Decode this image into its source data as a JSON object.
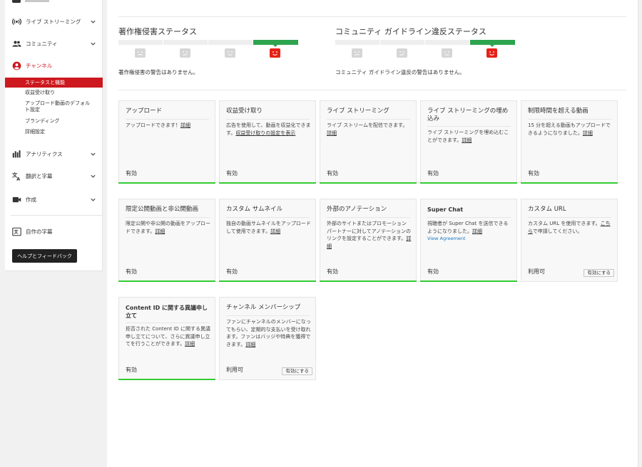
{
  "sidebar": {
    "items": [
      {
        "label": "ライブ ストリーミング",
        "icon": "live-streaming-icon"
      },
      {
        "label": "コミュニティ",
        "icon": "community-icon"
      },
      {
        "label": "チャンネル",
        "icon": "channel-icon"
      },
      {
        "label": "アナリティクス",
        "icon": "analytics-icon"
      },
      {
        "label": "翻訳と字幕",
        "icon": "translate-icon"
      },
      {
        "label": "作成",
        "icon": "create-icon"
      },
      {
        "label": "自作の字幕",
        "icon": "subtitles-icon"
      }
    ],
    "channel_subitems": [
      "ステータスと機能",
      "収益受け取り",
      "アップロード動画のデフォルト設定",
      "ブランディング",
      "詳細設定"
    ],
    "help_label": "ヘルプとフィードバック"
  },
  "copyright_status": {
    "title": "著作権侵害ステータス",
    "note": "著作権侵害の警告はありません。"
  },
  "guidelines_status": {
    "title": "コミュニティ ガイドライン違反ステータス",
    "note": "コミュニティ ガイドライン違反の警告はありません。"
  },
  "link_detail": "詳細",
  "cards": [
    {
      "title": "アップロード",
      "desc": "アップロードできます！",
      "link": "詳細",
      "status": "有効"
    },
    {
      "title": "収益受け取り",
      "desc": "広告を使用して、動画を収益化できます。",
      "link": "収益受け取りの設定を表示",
      "status": "有効"
    },
    {
      "title": "ライブ ストリーミング",
      "desc": "ライブ ストリームを配信できます。",
      "link": "詳細",
      "status": "有効"
    },
    {
      "title": "ライブ ストリーミングの埋め込み",
      "desc": "ライブ ストリーミングを埋め込むことができます。",
      "link": "詳細",
      "status": "有効"
    },
    {
      "title": "制限時間を超える動画",
      "desc": "15 分を超える動画もアップロードできるようになりました。",
      "link": "詳細",
      "status": "有効"
    },
    {
      "title": "限定公開動画と非公開動画",
      "desc": "限定公開や非公開の動画をアップロードできます。",
      "link": "詳細",
      "status": "有効"
    },
    {
      "title": "カスタム サムネイル",
      "desc": "独自の動画サムネイルをアップロードして使用できます。",
      "link": "詳細",
      "status": "有効"
    },
    {
      "title": "外部のアノテーション",
      "desc": "外部のサイトまたはプロモーション パートナーに対してアノテーションのリンクを設定することができます。",
      "link": "詳細",
      "status": "有効"
    },
    {
      "title": "Super Chat",
      "desc": "視聴者が Super Chat を送信できるようになりました。",
      "link": "詳細",
      "extra_link": "View Agreement",
      "status": "有効"
    },
    {
      "title": "カスタム URL",
      "desc_before": "カスタム URL を使用できます。",
      "desc_link": "こちら",
      "desc_after": "で申請してください。",
      "status": "利用可",
      "button": "有効にする"
    },
    {
      "title": "Content ID に関する異議申し立て",
      "desc": "拒否された Content ID に関する異議申し立てについて、さらに異議申し立てを行うことができます。",
      "link": "詳細",
      "status": "有効"
    },
    {
      "title": "チャンネル メンバーシップ",
      "desc": "ファンにチャンネルのメンバーになってもらい、定期的な支払いを受け取れます。ファンはバッジや特典を獲得できます。",
      "link": "詳細",
      "status": "利用可",
      "button": "有効にする"
    }
  ],
  "colors": {
    "accent_red": "#cc181e",
    "status_green": "#2ea44f",
    "enabled_bar": "#33cc33",
    "link_blue": "#167ac6"
  }
}
